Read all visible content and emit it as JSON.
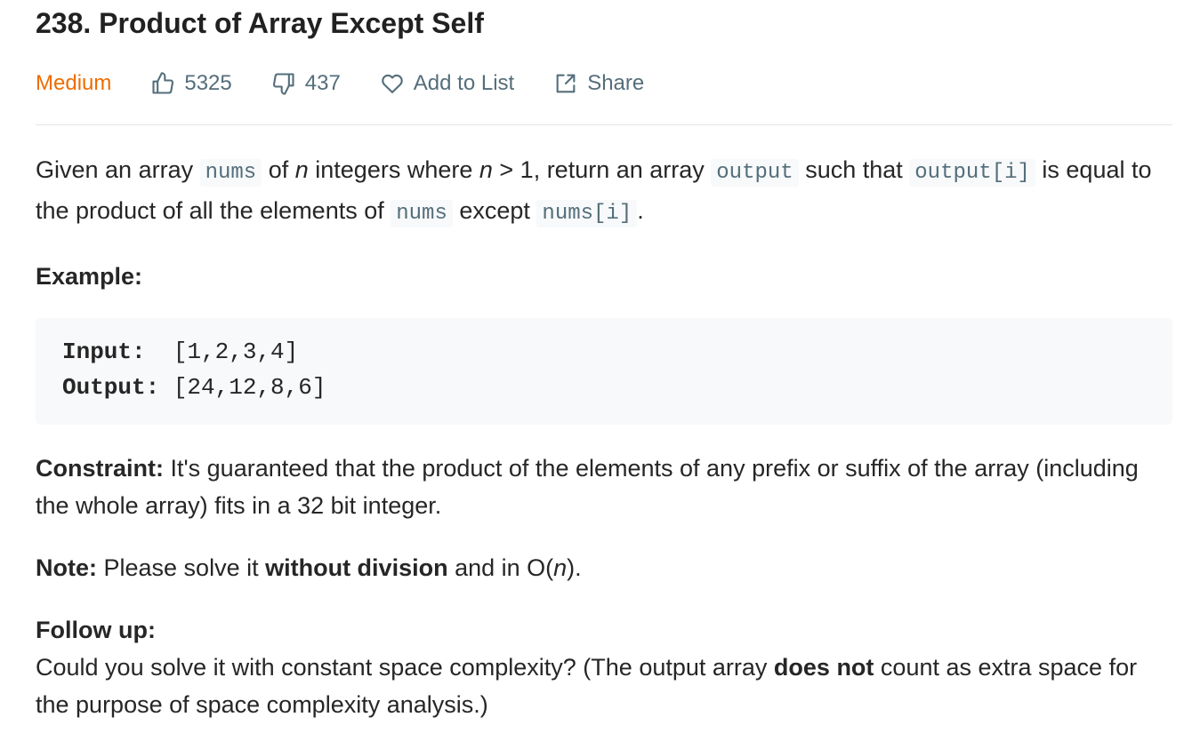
{
  "problem": {
    "title": "238. Product of Array Except Self",
    "difficulty": "Medium",
    "likes": "5325",
    "dislikes": "437",
    "add_to_list": "Add to List",
    "share": "Share"
  },
  "description": {
    "t1": "Given an array ",
    "c1": "nums",
    "t2": " of ",
    "v1": "n",
    "t3": " integers where ",
    "v2": "n",
    "t4": " > 1,  return an array ",
    "c2": "output",
    "t5": " such that ",
    "c3": "output[i]",
    "t6": " is equal to the product of all the elements of ",
    "c4": "nums",
    "t7": " except ",
    "c5": "nums[i]",
    "t8": "."
  },
  "example": {
    "label": "Example:",
    "input_key": "Input:",
    "input_value": "[1,2,3,4]",
    "output_key": "Output:",
    "output_value": "[24,12,8,6]"
  },
  "constraint": {
    "label": "Constraint:",
    "text": " It's guaranteed that the product of the elements of any prefix or suffix of the array (including the whole array) fits in a 32 bit integer."
  },
  "note": {
    "label": "Note:",
    "t1": " Please solve it ",
    "bold": "without division",
    "t2": " and in O(",
    "var": "n",
    "t3": ")."
  },
  "followup": {
    "label": "Follow up:",
    "t1": "Could you solve it with constant space complexity? (The output array ",
    "bold": "does not",
    "t2": " count as extra space for the purpose of space complexity analysis.)"
  }
}
